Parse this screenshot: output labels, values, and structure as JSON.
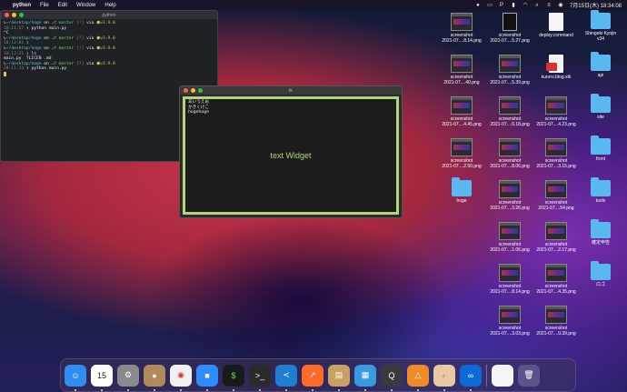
{
  "menubar": {
    "app": "python",
    "items": [
      "File",
      "Edit",
      "Window",
      "Help"
    ],
    "clock": "7月15日(木) 18:34:08"
  },
  "terminal": {
    "title": "python",
    "lines": [
      {
        "dir": "~/desktop/hoge",
        "on": "on",
        "branch": "master",
        "status": "[!]",
        "via": "via",
        "ver": "v3.9.0"
      },
      {
        "time": "18:11:57",
        "cmd": "python main.py"
      },
      {
        "prompt": "^C"
      },
      {
        "dir": "~/desktop/hoge",
        "on": "on",
        "branch": "master",
        "status": "[!]",
        "via": "via",
        "ver": "v3.9.0"
      },
      {
        "time": "18:12:01"
      },
      {
        "dir": "~/desktop/hoge",
        "on": "on",
        "branch": "master",
        "status": "[!]",
        "via": "via",
        "ver": "v3.9.0"
      },
      {
        "time": "18:12:21",
        "cmd": "ls"
      },
      {
        "files": "main.py  ?LICEN .md"
      },
      {
        "dir": "~/desktop/hoge",
        "on": "on",
        "branch": "master",
        "status": "[?]",
        "via": "via",
        "ver": "v3.9.0"
      },
      {
        "time": "18:11:13",
        "cmd": "python main.py"
      }
    ]
  },
  "tk": {
    "title": "tk",
    "lines": [
      "あいうえお",
      "かきくけこ",
      "hogehoge"
    ],
    "center": "text Widget"
  },
  "desktop": [
    {
      "kind": "thumb",
      "l1": "screenshot",
      "l2": "2021-07....8.14.png"
    },
    {
      "kind": "docdark",
      "l1": "screenshot",
      "l2": "2021-07....5.27.png"
    },
    {
      "kind": "doc",
      "l1": "deploy.command",
      "l2": ""
    },
    {
      "kind": "folder",
      "l1": "Shingeki Kyojin",
      "l2": "v34"
    },
    {
      "kind": "thumb",
      "l1": "screenshot",
      "l2": "2021-07....40.png"
    },
    {
      "kind": "thumb",
      "l1": "screenshot",
      "l2": "2021-07....5.39.png"
    },
    {
      "kind": "docred",
      "l1": "kuroro.blog.stk",
      "l2": ""
    },
    {
      "kind": "folder",
      "l1": "api",
      "l2": ""
    },
    {
      "kind": "thumb",
      "l1": "screenshot",
      "l2": "2021-07....4.45.png"
    },
    {
      "kind": "thumb",
      "l1": "screenshot",
      "l2": "2021-07....6.18.png"
    },
    {
      "kind": "thumb",
      "l1": "screenshot",
      "l2": "2021-07....4.23.png"
    },
    {
      "kind": "folder",
      "l1": "site",
      "l2": ""
    },
    {
      "kind": "thumb",
      "l1": "screenshot",
      "l2": "2021-07....2.50.png"
    },
    {
      "kind": "thumb",
      "l1": "screenshot",
      "l2": "2021-07....8.06.png"
    },
    {
      "kind": "thumb",
      "l1": "screenshot",
      "l2": "2021-07....3.15.png"
    },
    {
      "kind": "folder",
      "l1": "front",
      "l2": ""
    },
    {
      "kind": "folder",
      "l1": "hoge",
      "l2": ""
    },
    {
      "kind": "thumb",
      "l1": "screenshot",
      "l2": "2021-07....3.26.png"
    },
    {
      "kind": "thumb",
      "l1": "screenshot",
      "l2": "2021-07....54.png"
    },
    {
      "kind": "folder",
      "l1": "tools",
      "l2": ""
    },
    {
      "kind": "thumb",
      "l1": "screenshot",
      "l2": "2021-07....1.06.png"
    },
    {
      "kind": "thumb",
      "l1": "screenshot",
      "l2": "2021-07....2.17.png"
    },
    {
      "kind": "folder",
      "l1": "確定申告",
      "l2": ""
    },
    {
      "kind": "thumb",
      "l1": "screenshot",
      "l2": "2021-07....8.14.png"
    },
    {
      "kind": "thumb",
      "l1": "screenshot",
      "l2": "2021-07....4.35.png"
    },
    {
      "kind": "folder",
      "l1": "ロゴ",
      "l2": ""
    },
    {
      "kind": "thumb",
      "l1": "screenshot",
      "l2": "2021-07....3.03.png"
    },
    {
      "kind": "thumb",
      "l1": "screenshot",
      "l2": "2021-07....0.39.png"
    }
  ],
  "dock": [
    {
      "name": "finder",
      "color": "#2e8ef0",
      "glyph": "☺"
    },
    {
      "name": "calendar",
      "color": "#ffffff",
      "glyph": "15",
      "fg": "#222"
    },
    {
      "name": "system-preferences",
      "color": "#8a8a8a",
      "glyph": "⚙"
    },
    {
      "name": "contacts",
      "color": "#b08a5a",
      "glyph": "●"
    },
    {
      "name": "chrome",
      "color": "#f1f1f1",
      "glyph": "◉",
      "fg": "#d33"
    },
    {
      "name": "zoom",
      "color": "#2d8cff",
      "glyph": "■"
    },
    {
      "name": "terminal-green",
      "color": "#1a1a1a",
      "glyph": "$",
      "fg": "#7fcf5a"
    },
    {
      "name": "terminal",
      "color": "#2a2a2a",
      "glyph": ">_"
    },
    {
      "name": "vscode",
      "color": "#1e7fd0",
      "glyph": "≺"
    },
    {
      "name": "activity-chart",
      "color": "#ff6a2a",
      "glyph": "↗"
    },
    {
      "name": "toolbox",
      "color": "#c8a060",
      "glyph": "▤"
    },
    {
      "name": "docker",
      "color": "#3a9ae0",
      "glyph": "▦"
    },
    {
      "name": "quicktime",
      "color": "#3a3a3a",
      "glyph": "Q"
    },
    {
      "name": "diagram",
      "color": "#f08a24",
      "glyph": "△"
    },
    {
      "name": "preview",
      "color": "#e8c8a0",
      "glyph": "◐",
      "fg": "#e88"
    },
    {
      "name": "infinity",
      "color": "#0a6ad8",
      "glyph": "∞"
    },
    {
      "name": "document",
      "color": "#f4f4f4",
      "glyph": ""
    },
    {
      "name": "trash",
      "color": "rgba(200,200,220,0.25)",
      "glyph": "🗑"
    }
  ]
}
